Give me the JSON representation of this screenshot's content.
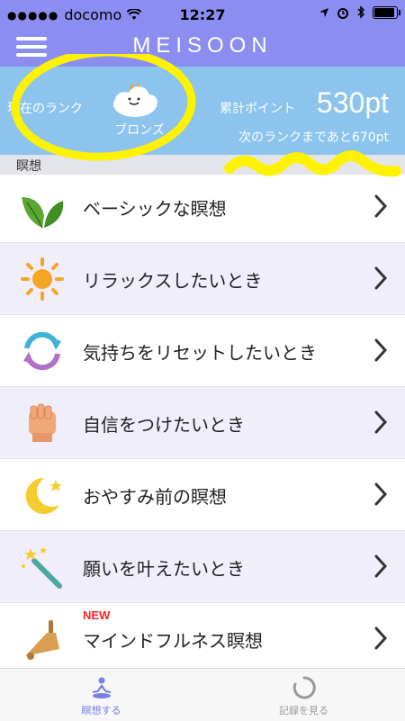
{
  "status_bar": {
    "carrier": "docomo",
    "time": "12:27"
  },
  "header": {
    "title": "MEISOON"
  },
  "rank": {
    "label": "現在のランク",
    "name": "ブロンズ",
    "points_label": "累計ポイント",
    "points_value": "530pt",
    "next_rank_text": "次のランクまであと670pt"
  },
  "section": {
    "label": "瞑想"
  },
  "menu_items": [
    {
      "label": "ベーシックな瞑想",
      "icon": "leaves-icon"
    },
    {
      "label": "リラックスしたいとき",
      "icon": "sun-icon"
    },
    {
      "label": "気持ちをリセットしたいとき",
      "icon": "refresh-icon"
    },
    {
      "label": "自信をつけたいとき",
      "icon": "fist-icon"
    },
    {
      "label": "おやすみ前の瞑想",
      "icon": "moon-icon"
    },
    {
      "label": "願いを叶えたいとき",
      "icon": "magic-wand-icon"
    },
    {
      "label": "マインドフルネス瞑想",
      "icon": "bell-icon",
      "badge": "NEW"
    }
  ],
  "tabs": [
    {
      "label": "瞑想する",
      "icon": "meditation-icon",
      "active": true
    },
    {
      "label": "記録を見る",
      "icon": "loading-icon",
      "active": false
    }
  ],
  "colors": {
    "header": "#8b8ef0",
    "rank_panel": "#8cc4ee",
    "accent": "#7a7ee6",
    "new_badge": "#ff2222",
    "annotation": "#fff200"
  }
}
